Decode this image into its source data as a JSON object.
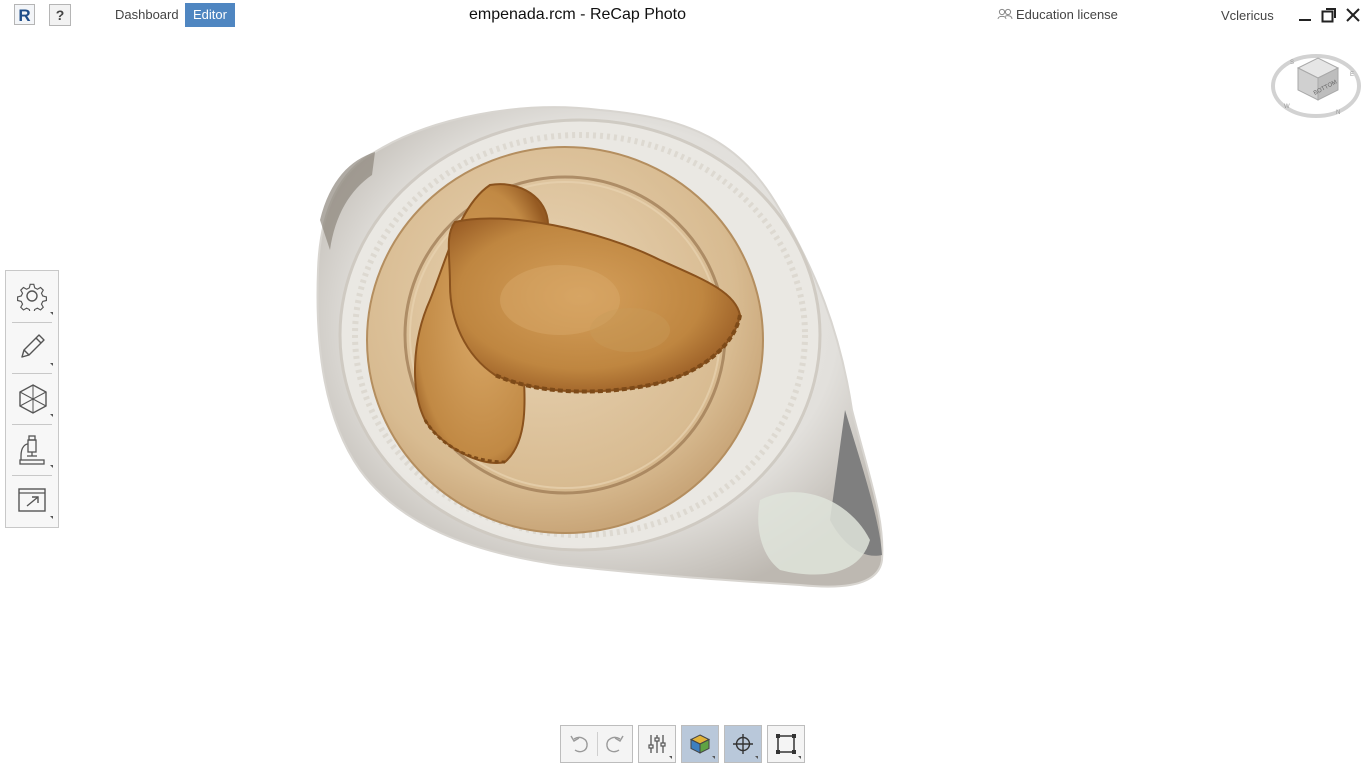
{
  "app": {
    "logo_letter": "R",
    "help_label": "?",
    "tabs": [
      {
        "label": "Dashboard",
        "active": false
      },
      {
        "label": "Editor",
        "active": true
      }
    ],
    "title": "empenada.rcm - ReCap Photo",
    "license": "Education license",
    "username": "Vclericus"
  },
  "window_controls": {
    "minimize_icon": "minimize-icon",
    "maximize_icon": "restore-icon",
    "close_icon": "close-icon"
  },
  "nav_cube": {
    "face_label": "BOTTOM",
    "compass": [
      "S",
      "E",
      "N",
      "W"
    ]
  },
  "left_toolbar": [
    {
      "icon": "gear-icon",
      "tooltip": "Settings"
    },
    {
      "icon": "pencil-icon",
      "tooltip": "Edit"
    },
    {
      "icon": "mesh-icon",
      "tooltip": "Mesh"
    },
    {
      "icon": "microscope-icon",
      "tooltip": "Analyze"
    },
    {
      "icon": "export-icon",
      "tooltip": "Export"
    }
  ],
  "bottom_toolbar": [
    {
      "icon": "undo-icon",
      "active": false
    },
    {
      "icon": "redo-icon",
      "active": false
    },
    {
      "icon": "sliders-icon",
      "active": false
    },
    {
      "icon": "textured-cube-icon",
      "active": true
    },
    {
      "icon": "crosshair-icon",
      "active": true
    },
    {
      "icon": "crop-box-icon",
      "active": false
    }
  ],
  "colors": {
    "accent": "#4f86c1",
    "active_button": "#b9c8da",
    "toolbar_bg": "#f7f7f7",
    "border": "#c8c8c8"
  }
}
